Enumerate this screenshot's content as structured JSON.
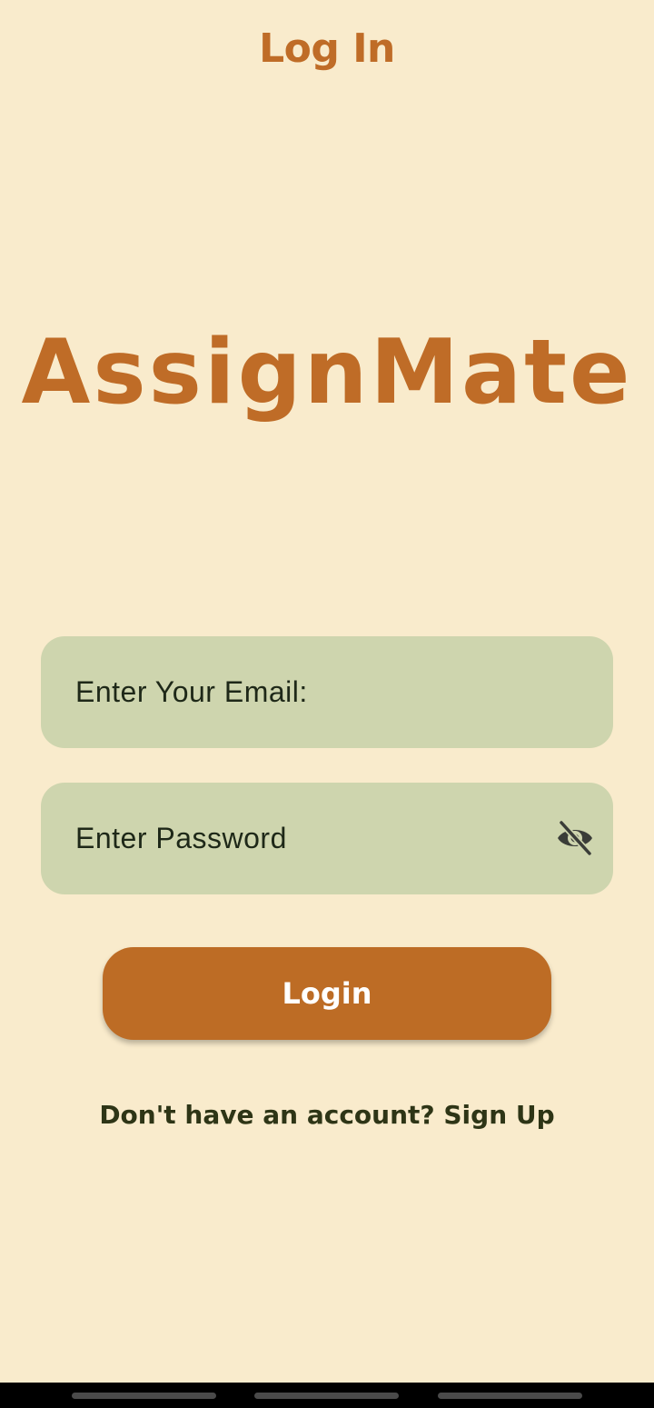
{
  "header": {
    "title": "Log In"
  },
  "brand": {
    "name": "AssignMate"
  },
  "form": {
    "email_placeholder": "Enter Your Email:",
    "password_placeholder": "Enter Password",
    "password_toggle_icon": "eye-off-icon",
    "login_label": "Login",
    "signup_prompt": "Don't have an account? Sign Up"
  },
  "colors": {
    "background": "#f9ebcc",
    "accent": "#bf6c27",
    "field": "#ced5ae",
    "button": "#bd6c25",
    "signup_text": "#2e3516"
  },
  "navigation_bar": {
    "items": [
      "nav-pill",
      "nav-pill",
      "nav-pill"
    ]
  }
}
